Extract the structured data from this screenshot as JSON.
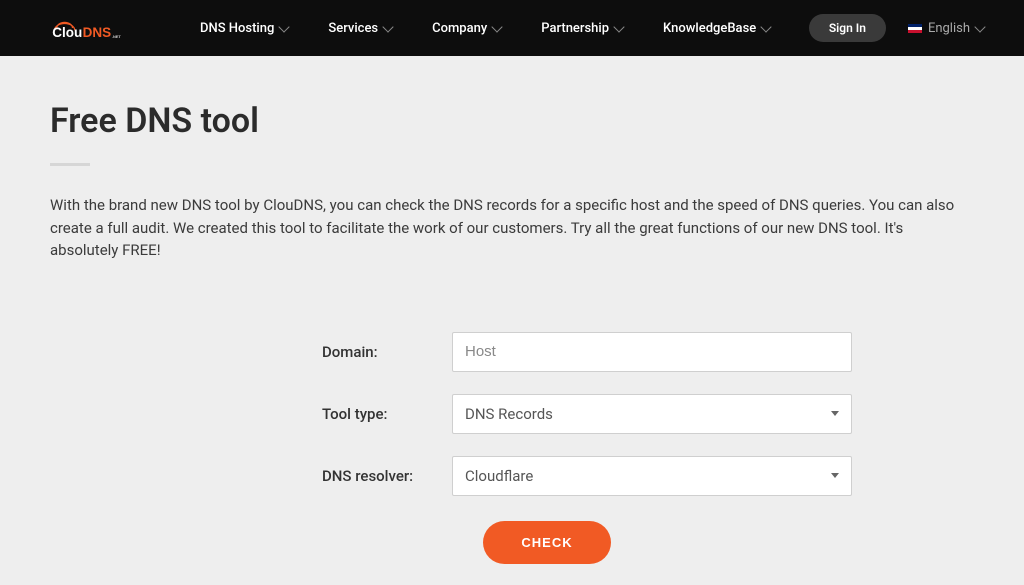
{
  "brand": {
    "name": "ClouDNS"
  },
  "nav": {
    "items": [
      {
        "label": "DNS Hosting"
      },
      {
        "label": "Services"
      },
      {
        "label": "Company"
      },
      {
        "label": "Partnership"
      },
      {
        "label": "KnowledgeBase"
      }
    ],
    "signin": "Sign In",
    "language": "English"
  },
  "page": {
    "title": "Free DNS tool",
    "description": "With the brand new DNS tool by ClouDNS, you can check the DNS records for a specific host and the speed of DNS queries. You can also create a full audit. We created this tool to facilitate the work of our customers. Try all the great functions of our new DNS tool. It's absolutely FREE!"
  },
  "form": {
    "domain_label": "Domain:",
    "domain_placeholder": "Host",
    "tooltype_label": "Tool type:",
    "tooltype_value": "DNS Records",
    "resolver_label": "DNS resolver:",
    "resolver_value": "Cloudflare",
    "submit": "CHECK"
  }
}
